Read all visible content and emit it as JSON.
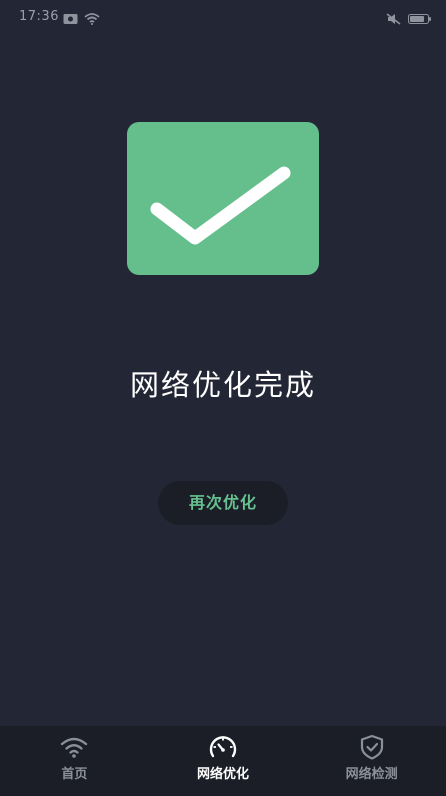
{
  "status_bar": {
    "time": "17:36"
  },
  "result": {
    "title": "网络优化完成",
    "icon": "checkmark-icon"
  },
  "actions": {
    "retry_label": "再次优化"
  },
  "bottom_nav": {
    "items": [
      {
        "label": "首页",
        "icon": "wifi-icon",
        "active": false
      },
      {
        "label": "网络优化",
        "icon": "speedometer-icon",
        "active": true
      },
      {
        "label": "网络检测",
        "icon": "shield-check-icon",
        "active": false
      }
    ]
  },
  "colors": {
    "background": "#232634",
    "accent": "#65bf8c",
    "nav_background": "#1b1e27"
  }
}
